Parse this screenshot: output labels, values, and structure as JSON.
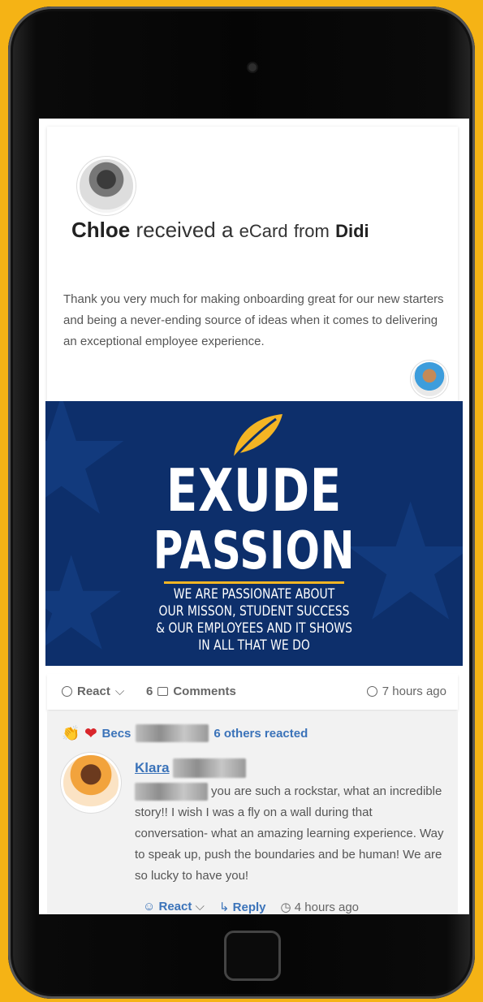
{
  "post": {
    "recipient": "Chloe",
    "verb": "received a",
    "item": "eCard",
    "from_word": "from",
    "sender": "Didi",
    "message": "Thank you very much for making onboarding great for our new starters and being a never-ending source of ideas when it comes to delivering an exceptional employee experience."
  },
  "banner": {
    "line1": "EXUDE",
    "line2": "PASSION",
    "subtitle_lines": [
      "WE ARE PASSIONATE ABOUT",
      "OUR MISSON, STUDENT SUCCESS",
      "& OUR EMPLOYEES AND IT SHOWS",
      "IN ALL THAT WE DO"
    ],
    "bg_color": "#0d2f6b",
    "accent_color": "#f4b524"
  },
  "actions": {
    "react_label": "React",
    "comments_count": "6",
    "comments_label": "Comments",
    "time": "7 hours ago"
  },
  "reactions": {
    "first_name": "Becs",
    "others_text": "6 others reacted"
  },
  "comment": {
    "author": "Klara",
    "text": "you are such a rockstar, what an incredible story!! I wish I was a fly on a wall during that conversation- what an amazing learning experience. Way to speak up, push the boundaries and be human! We are so lucky to have you!",
    "react_label": "React",
    "reply_label": "Reply",
    "time": "4 hours ago"
  },
  "icons": {
    "chevron": "chevron-down-icon",
    "comment": "comment-icon",
    "clock": "clock-icon",
    "reply": "reply-arrow-icon",
    "smiley": "smiley-icon"
  }
}
